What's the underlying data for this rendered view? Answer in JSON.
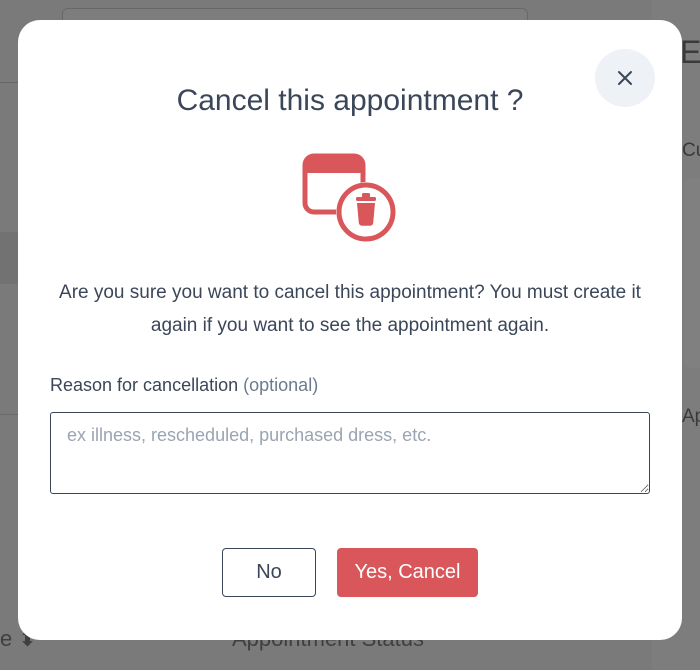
{
  "background": {
    "sort_label": "e ⬍",
    "status_column": "Appointment Status",
    "panel_title": "Ec",
    "panel_section_1": "Cu",
    "panel_section_2": "Ap"
  },
  "modal": {
    "title": "Cancel this appointment ?",
    "close_icon": "close-icon",
    "icon": "calendar-trash-icon",
    "message": "Are you sure you want to cancel this appointment? You must create it again if you want to see the appointment again.",
    "reason_label": "Reason for cancellation",
    "reason_optional": "(optional)",
    "reason_value": "",
    "reason_placeholder": "ex illness, rescheduled, purchased dress, etc.",
    "no_label": "No",
    "yes_label": "Yes, Cancel"
  },
  "colors": {
    "accent": "#d9575a",
    "text": "#3b4659",
    "overlay": "#6e6e6e"
  }
}
